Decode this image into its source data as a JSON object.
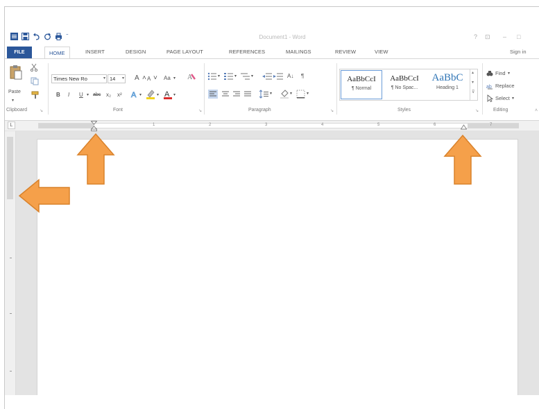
{
  "window": {
    "title": "Document1 - Word",
    "controls": [
      "?",
      "⊡",
      "–",
      "□"
    ]
  },
  "quick_access": {
    "icons": [
      "word-logo-icon",
      "save-icon",
      "undo-icon",
      "redo-icon",
      "print-preview-icon",
      "customize-icon"
    ]
  },
  "tabs": {
    "file": "FILE",
    "home": "HOME",
    "insert": "INSERT",
    "design": "DESIGN",
    "page_layout": "PAGE LAYOUT",
    "references": "REFERENCES",
    "mailings": "MAILINGS",
    "review": "REVIEW",
    "view": "VIEW",
    "sign_in": "Sign in"
  },
  "clipboard": {
    "paste_label": "Paste",
    "group_label": "Clipboard"
  },
  "font": {
    "name": "Times New Ro",
    "size": "14",
    "grow": "A",
    "shrink": "A",
    "change_case": "Aa",
    "bold": "B",
    "italic": "I",
    "underline": "U",
    "strikethrough": "abc",
    "subscript": "x₂",
    "superscript": "x²",
    "group_label": "Font"
  },
  "paragraph": {
    "sort": "A↓",
    "pilcrow": "¶",
    "group_label": "Paragraph"
  },
  "styles": {
    "items": [
      {
        "sample": "AaBbCcI",
        "name": "¶ Normal"
      },
      {
        "sample": "AaBbCcI",
        "name": "¶ No Spac..."
      },
      {
        "sample": "AaBbC",
        "name": "Heading 1"
      }
    ],
    "group_label": "Styles"
  },
  "editing": {
    "find": "Find",
    "replace": "Replace",
    "select": "Select",
    "group_label": "Editing"
  },
  "ruler": {
    "tab_selector": "L",
    "numbers": [
      "1",
      "2",
      "3",
      "4",
      "5",
      "6",
      "7"
    ]
  },
  "colors": {
    "accent": "#2b579a",
    "arrow_fill": "#f5a04a",
    "arrow_stroke": "#d9822b",
    "highlight": "#f2d21b",
    "font_color": "#d92b2b"
  }
}
